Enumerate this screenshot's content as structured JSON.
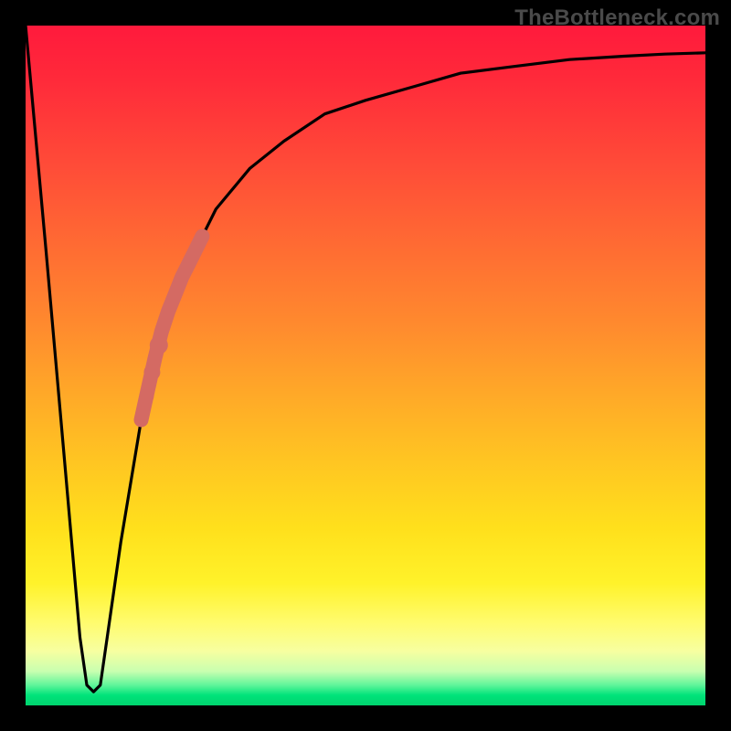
{
  "watermark": "TheBottleneck.com",
  "chart_data": {
    "type": "line",
    "title": "",
    "xlabel": "",
    "ylabel": "",
    "xlim": [
      0,
      100
    ],
    "ylim": [
      0,
      100
    ],
    "grid": false,
    "series": [
      {
        "name": "bottleneck-curve",
        "color": "#000000",
        "x": [
          0,
          3,
          6,
          8,
          9,
          10,
          11,
          12,
          14,
          17,
          20,
          24,
          28,
          33,
          38,
          44,
          50,
          57,
          64,
          72,
          80,
          88,
          94,
          100
        ],
        "values": [
          100,
          67,
          33,
          10,
          3,
          2,
          3,
          10,
          24,
          42,
          55,
          65,
          73,
          79,
          83,
          87,
          89,
          91,
          93,
          94,
          95,
          95.5,
          95.8,
          96
        ]
      }
    ],
    "highlight_segment": {
      "name": "marker-band",
      "color": "#d46a63",
      "mode": "thick-line",
      "x": [
        17.0,
        18.0,
        19.0,
        20.0,
        21.0,
        22.0,
        23.0,
        24.0,
        25.0,
        26.0
      ],
      "values": [
        42.0,
        46.5,
        51.0,
        55.0,
        58.0,
        60.5,
        63.0,
        65.0,
        67.0,
        69.0
      ]
    },
    "highlight_dots": {
      "name": "marker-dots",
      "color": "#d46a63",
      "x": [
        17.8,
        18.6,
        19.6
      ],
      "values": [
        45.5,
        49.0,
        53.0
      ]
    }
  }
}
